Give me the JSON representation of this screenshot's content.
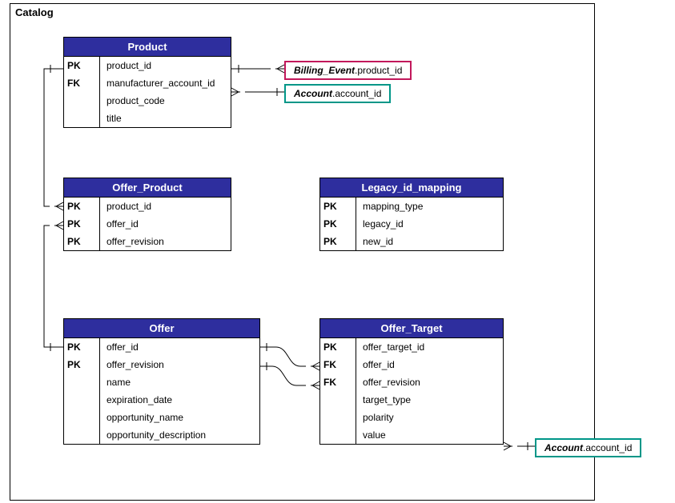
{
  "container": {
    "title": "Catalog"
  },
  "entities": {
    "product": {
      "title": "Product",
      "rows": [
        {
          "key": "PK",
          "field": "product_id"
        },
        {
          "key": "FK",
          "field": "manufacturer_account_id"
        },
        {
          "key": "",
          "field": "product_code"
        },
        {
          "key": "",
          "field": "title"
        }
      ]
    },
    "offer_product": {
      "title": "Offer_Product",
      "rows": [
        {
          "key": "PK",
          "field": "product_id"
        },
        {
          "key": "PK",
          "field": "offer_id"
        },
        {
          "key": "PK",
          "field": "offer_revision"
        }
      ]
    },
    "legacy_id_mapping": {
      "title": "Legacy_id_mapping",
      "rows": [
        {
          "key": "PK",
          "field": "mapping_type"
        },
        {
          "key": "PK",
          "field": "legacy_id"
        },
        {
          "key": "PK",
          "field": "new_id"
        }
      ]
    },
    "offer": {
      "title": "Offer",
      "rows": [
        {
          "key": "PK",
          "field": "offer_id"
        },
        {
          "key": "PK",
          "field": "offer_revision"
        },
        {
          "key": "",
          "field": "name"
        },
        {
          "key": "",
          "field": "expiration_date"
        },
        {
          "key": "",
          "field": "opportunity_name"
        },
        {
          "key": "",
          "field": "opportunity_description"
        }
      ]
    },
    "offer_target": {
      "title": "Offer_Target",
      "rows": [
        {
          "key": "PK",
          "field": "offer_target_id"
        },
        {
          "key": "FK",
          "field": "offer_id"
        },
        {
          "key": "FK",
          "field": "offer_revision"
        },
        {
          "key": "",
          "field": "target_type"
        },
        {
          "key": "",
          "field": "polarity"
        },
        {
          "key": "",
          "field": "value"
        }
      ]
    }
  },
  "refs": {
    "billing_event_product_id": {
      "entity": "Billing_Event",
      "field": ".product_id",
      "color": "#C2185B"
    },
    "account_account_id_top": {
      "entity": "Account",
      "field": ".account_id",
      "color": "#009688"
    },
    "account_account_id_bot": {
      "entity": "Account",
      "field": ".account_id",
      "color": "#009688"
    }
  }
}
